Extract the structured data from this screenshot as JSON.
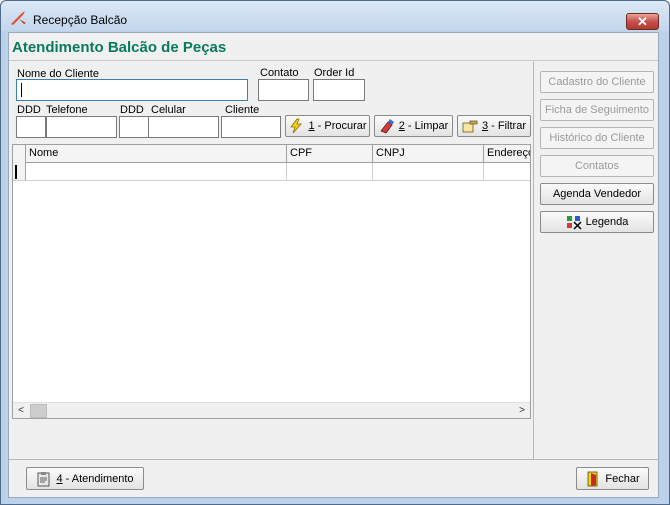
{
  "window": {
    "title": "Recepção Balcão",
    "close_glyph": "✕"
  },
  "page": {
    "title": "Atendimento Balcão de Peças"
  },
  "form": {
    "nome_cliente_label": "Nome do Cliente",
    "nome_cliente_value": "",
    "contato_label": "Contato",
    "contato_value": "",
    "order_id_label": "Order Id",
    "order_id_value": "",
    "ddd1_label": "DDD",
    "telefone_label": "Telefone",
    "ddd2_label": "DDD",
    "celular_label": "Celular",
    "cliente_label": "Cliente"
  },
  "actions": {
    "procurar": {
      "key": "1",
      "label": " - Procurar",
      "icon": "lightning-icon"
    },
    "limpar": {
      "key": "2",
      "label": " - Limpar",
      "icon": "eraser-icon"
    },
    "filtrar": {
      "key": "3",
      "label": " - Filtrar",
      "icon": "filter-hand-icon"
    }
  },
  "grid": {
    "columns": [
      "Nome",
      "CPF",
      "CNPJ",
      "Endereço"
    ],
    "rows": [
      [
        "",
        "",
        "",
        ""
      ]
    ]
  },
  "side_buttons": [
    {
      "label": "Cadastro do Cliente",
      "enabled": false
    },
    {
      "label": "Ficha de Seguimento",
      "enabled": false
    },
    {
      "label": "Histórico do Cliente",
      "enabled": false
    },
    {
      "label": "Contatos",
      "enabled": false
    },
    {
      "label": "Agenda Vendedor",
      "enabled": true
    },
    {
      "label": "Legenda",
      "enabled": true,
      "icon": "legend-icon"
    }
  ],
  "footer": {
    "atendimento": {
      "key": "4",
      "label": " - Atendimento",
      "icon": "clipboard-icon"
    },
    "fechar": {
      "label": "Fechar",
      "icon": "door-exit-icon"
    }
  },
  "colors": {
    "title_green": "#0a7a5c",
    "titlebar": "#c3d6ec"
  }
}
